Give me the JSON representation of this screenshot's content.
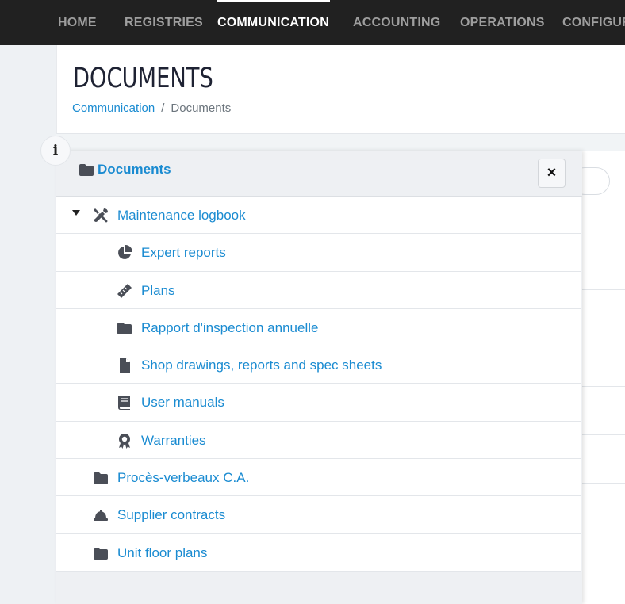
{
  "nav": {
    "items": [
      {
        "label": "HOME"
      },
      {
        "label": "REGISTRIES"
      },
      {
        "label": "COMMUNICATION"
      },
      {
        "label": "ACCOUNTING"
      },
      {
        "label": "OPERATIONS"
      },
      {
        "label": "CONFIGUR"
      }
    ],
    "active": "COMMUNICATION"
  },
  "page": {
    "title": "DOCUMENTS",
    "breadcrumb": {
      "parent": "Communication",
      "separator": "/",
      "current": "Documents"
    }
  },
  "info_button": {
    "label": "i"
  },
  "panel": {
    "title": "Documents",
    "close_label": "×",
    "tree": [
      {
        "label": "Maintenance logbook",
        "icon": "tools-icon",
        "expanded": true
      },
      {
        "label": "Expert reports",
        "icon": "pie-chart-icon"
      },
      {
        "label": "Plans",
        "icon": "ruler-icon"
      },
      {
        "label": "Rapport d'inspection annuelle",
        "icon": "folder-icon"
      },
      {
        "label": "Shop drawings, reports and spec sheets",
        "icon": "file-icon"
      },
      {
        "label": "User manuals",
        "icon": "book-icon"
      },
      {
        "label": "Warranties",
        "icon": "award-icon"
      },
      {
        "label": "Procès-verbeaux C.A.",
        "icon": "folder-icon"
      },
      {
        "label": "Supplier contracts",
        "icon": "hard-hat-icon"
      },
      {
        "label": "Unit floor plans",
        "icon": "folder-icon"
      }
    ]
  },
  "colors": {
    "link": "#1a8bd1",
    "nav_bg": "#212121",
    "icon": "#4a4e57"
  }
}
